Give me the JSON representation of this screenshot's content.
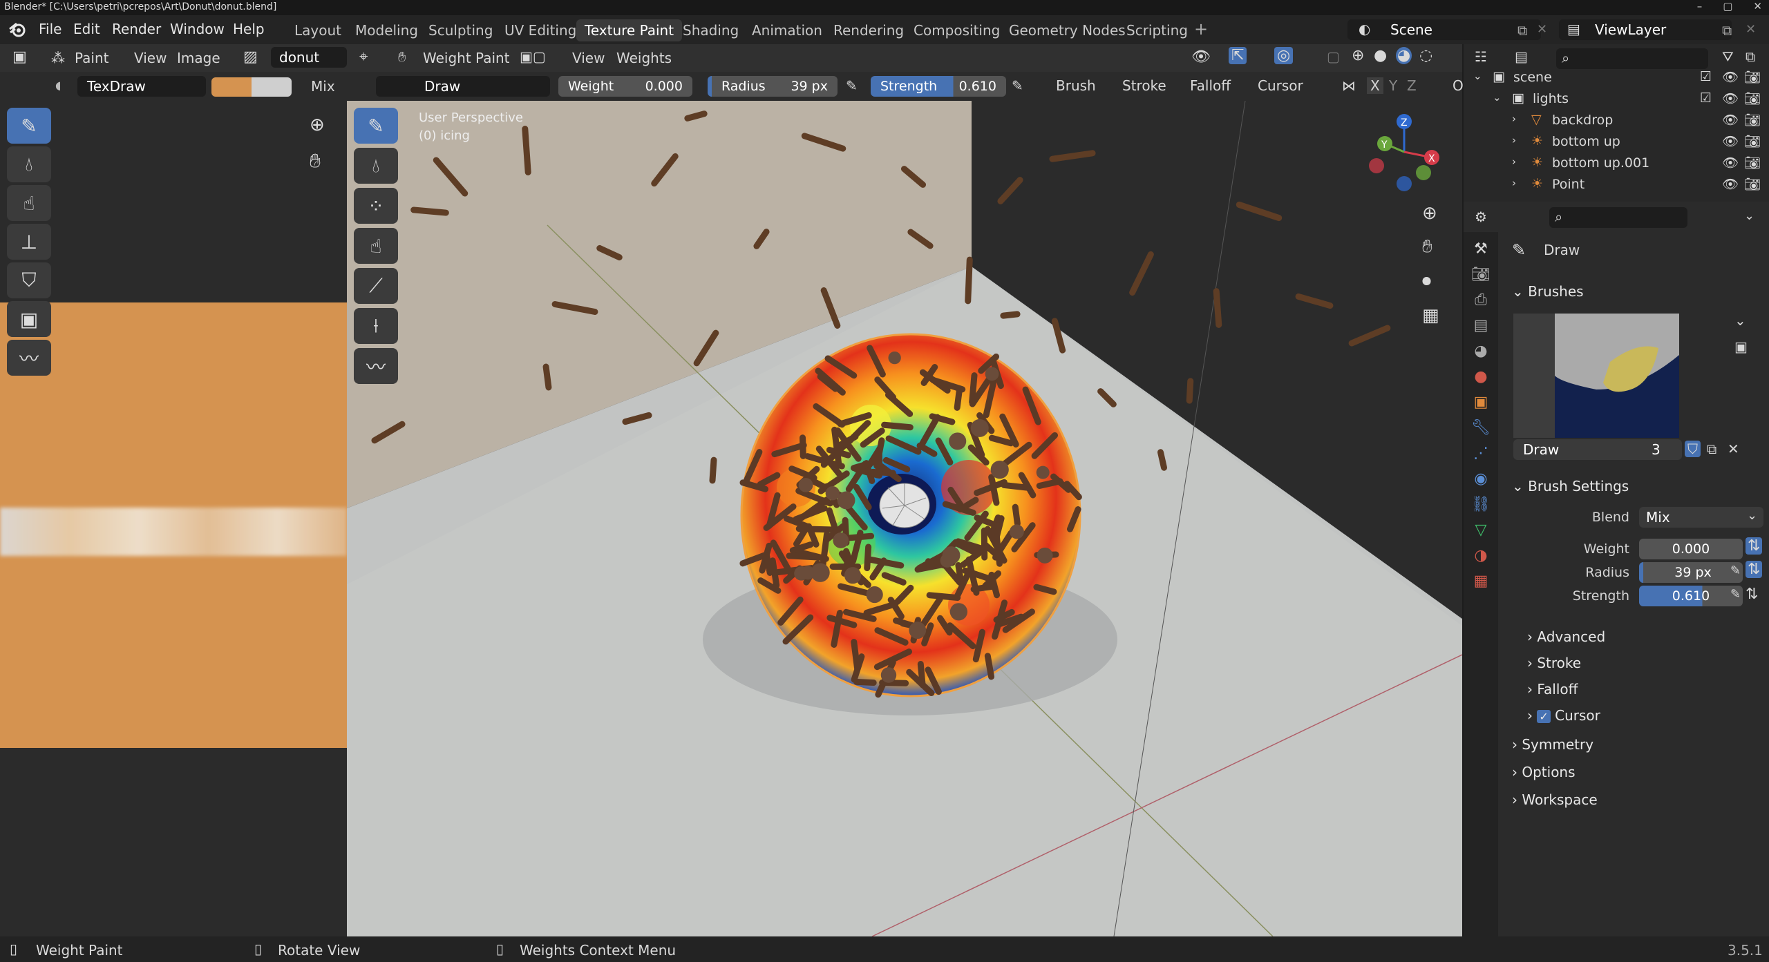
{
  "titlebar": {
    "title": "Blender* [C:\\Users\\petri\\pcrepos\\Art\\Donut\\donut.blend]"
  },
  "menu": [
    "File",
    "Edit",
    "Render",
    "Window",
    "Help"
  ],
  "workspaces": [
    "Layout",
    "Modeling",
    "Sculpting",
    "UV Editing",
    "Texture Paint",
    "Shading",
    "Animation",
    "Rendering",
    "Compositing",
    "Geometry Nodes",
    "Scripting"
  ],
  "active_workspace": "Texture Paint",
  "scene": {
    "name": "Scene",
    "view_layer": "ViewLayer"
  },
  "image_editor": {
    "mode": "Paint",
    "view": "View",
    "image": "Image",
    "image_name": "donut",
    "brush_name": "TexDraw",
    "blend": "Mix",
    "color1": "#d59350",
    "color2": "#cfcfcf"
  },
  "viewport": {
    "mode": "Weight Paint",
    "menus": [
      "View",
      "Weights"
    ],
    "perspective": "User Perspective",
    "object": "(0) icing",
    "brush": "Draw",
    "weight_label": "Weight",
    "weight_value": "0.000",
    "radius_label": "Radius",
    "radius_value": "39 px",
    "strength_label": "Strength",
    "strength_value": "0.610",
    "dropdowns": [
      "Brush",
      "Stroke",
      "Falloff",
      "Cursor"
    ],
    "axes": [
      "X",
      "Y",
      "Z"
    ],
    "extra": "O"
  },
  "outliner": {
    "items": [
      {
        "label": "scene",
        "indent": 0
      },
      {
        "label": "lights",
        "indent": 1
      },
      {
        "label": "backdrop",
        "indent": 2
      },
      {
        "label": "bottom up",
        "indent": 2
      },
      {
        "label": "bottom up.001",
        "indent": 2
      },
      {
        "label": "Point",
        "indent": 2
      }
    ]
  },
  "properties": {
    "tool_name": "Draw",
    "brushes_header": "Brushes",
    "brush_name": "Draw",
    "brush_users": "3",
    "brush_settings_header": "Brush Settings",
    "blend_label": "Blend",
    "blend_value": "Mix",
    "weight_label": "Weight",
    "weight_value": "0.000",
    "radius_label": "Radius",
    "radius_value": "39 px",
    "strength_label": "Strength",
    "strength_value": "0.610",
    "strength_fill": 0.61,
    "subpanels": [
      "Advanced",
      "Stroke",
      "Falloff",
      "Cursor"
    ],
    "panels": [
      "Symmetry",
      "Options",
      "Workspace"
    ]
  },
  "statusbar": {
    "items": [
      "Weight Paint",
      "Rotate View",
      "Weights Context Menu"
    ],
    "version": "3.5.1"
  },
  "colors": {
    "accent": "#4772b3",
    "orange": "#d59350"
  }
}
